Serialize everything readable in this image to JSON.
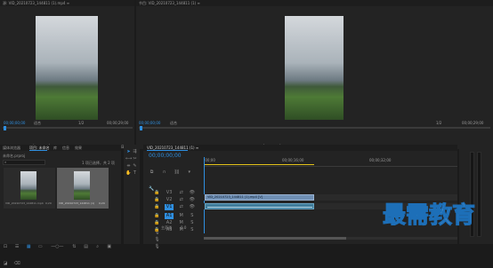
{
  "source_monitor": {
    "tab_label": "源: VID_20210723_144811 (1).mp4 ≡",
    "timecode_left": "00;00;00;00",
    "fit_label": "适合",
    "page_label": "1/2",
    "timecode_right": "00;00;29;00"
  },
  "program_monitor": {
    "tab_label": "节目: VID_20210723_144811 (1) ≡",
    "timecode_left": "00;00;00;00",
    "fit_label": "适合",
    "page_label": "1/2",
    "timecode_right": "00;00;29;00"
  },
  "project_panel": {
    "tabs": [
      "项目: 未命名",
      "媒体浏览器",
      "库",
      "信息",
      "效果"
    ],
    "path_label": "未命名.prproj",
    "item_count": "1 项已选择，共 2 项",
    "items": [
      {
        "name": "VID_20210723_144811.mp4",
        "duration": "0;29"
      },
      {
        "name": "VID_20210723_144811 (1)",
        "duration": "0;29"
      }
    ]
  },
  "timeline": {
    "tab_label": "VID_20210723_144811 (1) ≡",
    "timecode": "00;00;00;00",
    "ruler_labels": [
      ":00;00",
      "00;00;16;00",
      "00;00;32;00"
    ],
    "video_tracks": [
      "V3",
      "V2",
      "V1"
    ],
    "audio_tracks": [
      "A1",
      "A2",
      "A3"
    ],
    "master_label": "主声道",
    "master_value": "0.0",
    "clip_label": "VID_20210723_144811 (1).mp4 [V]"
  },
  "watermark": "最需教育",
  "colors": {
    "accent_blue": "#2f8fe0",
    "playhead_yellow": "#e3c21a",
    "clip_video": "#6f8fb4",
    "clip_audio": "#3f7c9a"
  }
}
